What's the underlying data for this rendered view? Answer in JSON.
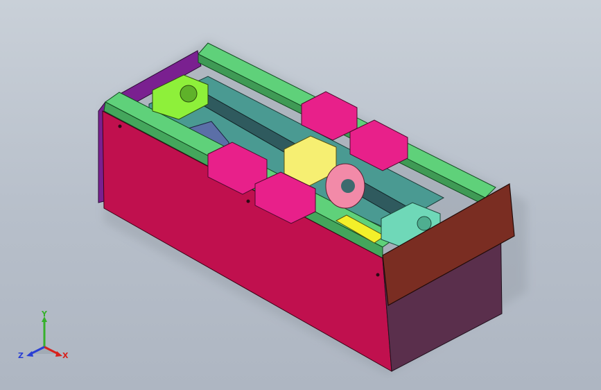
{
  "viewport": {
    "background": "#c0c8d1"
  },
  "colors": {
    "base_front": "#c0104e",
    "base_side": "#5a2f4c",
    "back_plate": "#7a2090",
    "rail": "#5fd17a",
    "carriage": "#e8208a",
    "support_block_fixed": "#8ef03a",
    "support_block_floating": "#6fd8b8",
    "nut_housing": "#f6ef72",
    "nut_flange": "#f28aa8",
    "screw": "#2f5a5e",
    "end_plate": "#7a2d22",
    "stop_block": "#f3f02a"
  },
  "triad": {
    "x_label": "X",
    "y_label": "Y",
    "z_label": "Z",
    "x_color": "#d8201c",
    "y_color": "#36b02b",
    "z_color": "#2a3fd4"
  }
}
